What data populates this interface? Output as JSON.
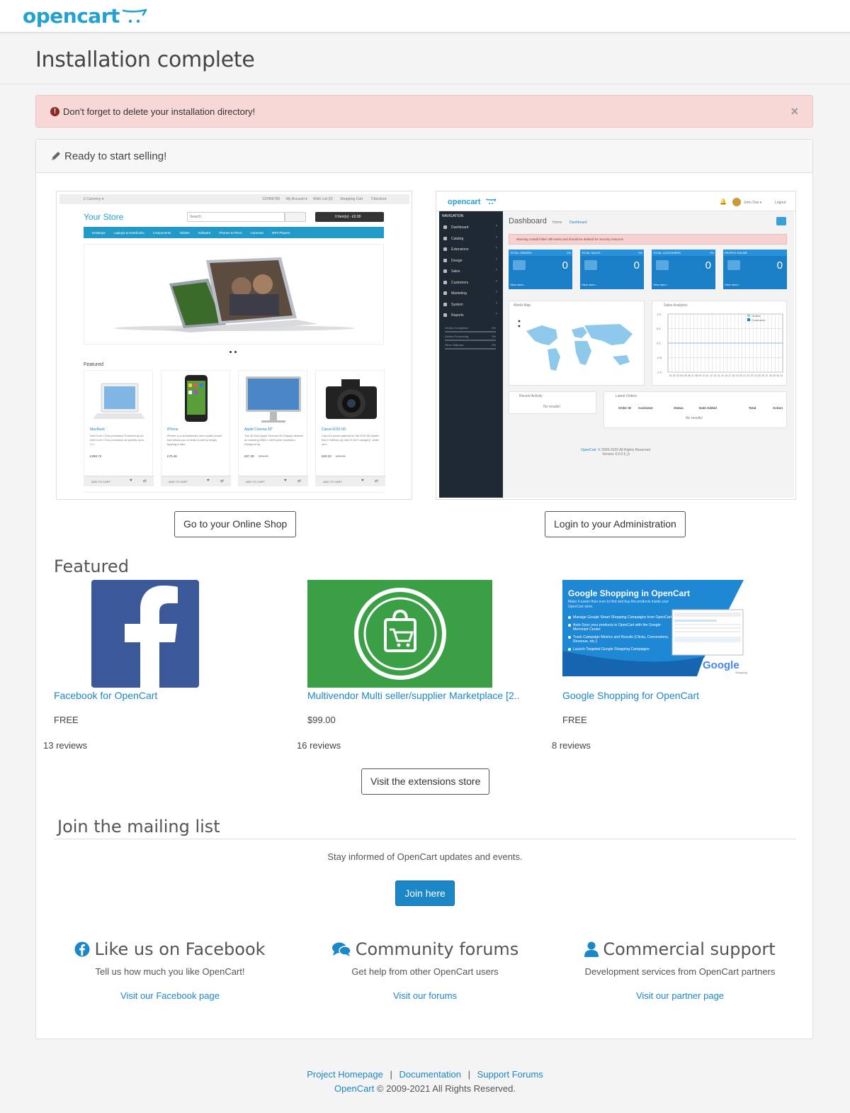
{
  "header": {
    "logo": "opencart"
  },
  "page_title": "Installation complete",
  "alert": {
    "text": "Don't forget to delete your installation directory!",
    "close": "×"
  },
  "panel": {
    "title": "Ready to start selling!"
  },
  "store_preview": {
    "store_name": "Your Store",
    "currency": "£ Currency ▾",
    "phone": "123456789",
    "my_account": "My Account ▾",
    "wish_list": "Wish List (0)",
    "shopping_cart": "Shopping Cart",
    "checkout": "Checkout",
    "search_placeholder": "Search",
    "cart": "0 item(s) - £0.00",
    "menu": [
      "Desktops",
      "Laptops & Notebooks",
      "Components",
      "Tablets",
      "Software",
      "Phones & PDAs",
      "Cameras",
      "MP3 Players"
    ],
    "featured": "Featured",
    "products": [
      {
        "name": "MacBook",
        "desc": "Intel Core 2 Duo processor Powered by an Intel Core 2 Duo processor at speeds up to 2.1..",
        "price": "£368.73",
        "old": ""
      },
      {
        "name": "iPhone",
        "desc": "iPhone is a revolutionary new mobile phone that allows you to make a call by simply tapping a nam..",
        "price": "£75.46",
        "old": ""
      },
      {
        "name": "Apple Cinema 30\"",
        "desc": "The 30-inch Apple Cinema HD Display delivers an amazing 2560 x 1600 pixel resolution. Designed sp..",
        "price": "£67.38",
        "old": "£74.75"
      },
      {
        "name": "Canon EOS 5D",
        "desc": "Canon's press material for the EOS 5D states that it 'defines (a) new D-SLR category', while we'r..",
        "price": "£60.03",
        "old": "£74.75"
      }
    ],
    "add_to_cart": "ADD TO CART"
  },
  "admin_preview": {
    "logo": "opencart",
    "user": "John Doe ▾",
    "logout": "Logout",
    "navigation": "NAVIGATION",
    "nav": [
      "Dashboard",
      "Catalog",
      "Extensions",
      "Design",
      "Sales",
      "Customers",
      "Marketing",
      "System",
      "Reports"
    ],
    "stats_side": [
      "Orders Completed",
      "Orders Processing",
      "Other Statuses"
    ],
    "stats_side_pct": "0%",
    "dashboard": "Dashboard",
    "breadcrumb_home": "Home",
    "breadcrumb_current": "Dashboard",
    "warning": "Warning: Install folder still exists and should be deleted for security reasons!",
    "tiles": [
      {
        "label": "TOTAL ORDERS",
        "pct": "0%",
        "value": "0",
        "more": "View more..."
      },
      {
        "label": "TOTAL SALES",
        "pct": "0%",
        "value": "0",
        "more": "View more..."
      },
      {
        "label": "TOTAL CUSTOMERS",
        "pct": "0%",
        "value": "0",
        "more": "View more..."
      },
      {
        "label": "PEOPLE ONLINE",
        "pct": "",
        "value": "0",
        "more": "View more..."
      }
    ],
    "world_map": "World Map",
    "sales_analytics": "Sales Analytics",
    "legend": [
      "Orders",
      "Customers"
    ],
    "y_ticks": [
      "1.0",
      "0.5",
      "0.0",
      "-0.5",
      "-1.0"
    ],
    "recent_activity": "Recent Activity",
    "no_results": "No results!",
    "latest_orders": "Latest Orders",
    "order_cols": [
      "Order ID",
      "Customer",
      "Status",
      "Date Added",
      "Total",
      "Action"
    ],
    "footer_brand": "OpenCart",
    "footer_copy": "© 2009-2020 All Rights Reserved.",
    "footer_version": "Version 4.0.0.0_b"
  },
  "buttons": {
    "shop": "Go to your Online Shop",
    "admin": "Login to your Administration",
    "extensions": "Visit the extensions store",
    "join": "Join here"
  },
  "featured": {
    "heading": "Featured",
    "items": [
      {
        "name": "Facebook for OpenCart",
        "price": "FREE",
        "reviews": "13 reviews"
      },
      {
        "name": "Multivendor Multi seller/supplier Marketplace [2..",
        "price": "$99.00",
        "reviews": "16 reviews"
      },
      {
        "name": "Google Shopping for OpenCart",
        "price": "FREE",
        "reviews": "8 reviews"
      }
    ],
    "google_banner": {
      "title": "Google Shopping in OpenCart",
      "sub": "Make it easier than ever to find and buy the products inside your OpenCart store.",
      "bullets": [
        "Manage Google Smart Shopping Campaigns from OpenCart",
        "Auto-Sync your products in OpenCart with the Google Merchant Center",
        "Track Campaign Metrics and Results (Clicks, Conversions, Revenue, etc.)",
        "Launch Targeted Google Shopping Campaigns"
      ],
      "brand": "Google",
      "brand_sub": "Shopping"
    }
  },
  "mailing": {
    "heading": "Join the mailing list",
    "text": "Stay informed of OpenCart updates and events."
  },
  "social": [
    {
      "title": "Like us on Facebook",
      "sub": "Tell us how much you like OpenCart!",
      "link": "Visit our Facebook page"
    },
    {
      "title": "Community forums",
      "sub": "Get help from other OpenCart users",
      "link": "Visit our forums"
    },
    {
      "title": "Commercial support",
      "sub": "Development services from OpenCart partners",
      "link": "Visit our partner page"
    }
  ],
  "footer": {
    "links": [
      "Project Homepage",
      "Documentation",
      "Support Forums"
    ],
    "separator": "|",
    "brand": "OpenCart",
    "copyright": "© 2009-2021 All Rights Reserved."
  },
  "colors": {
    "brand": "#23a1d1",
    "link": "#1b87c7",
    "alert_bg": "#f8d8d6",
    "admin_sidebar": "#1f2933",
    "tile": "#1b7fc7"
  }
}
